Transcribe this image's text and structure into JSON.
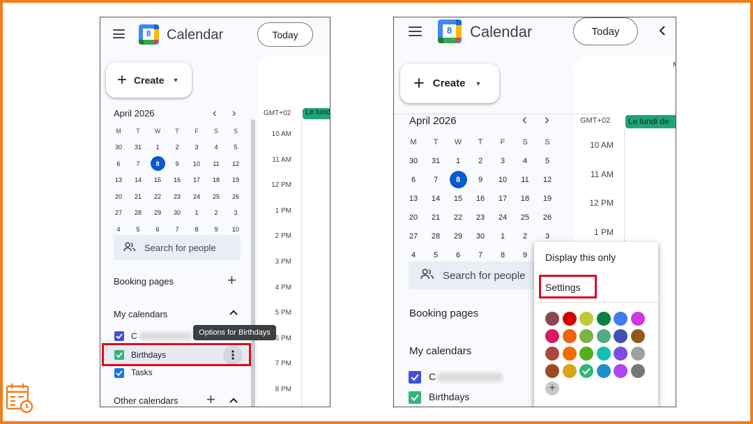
{
  "app": {
    "title": "Calendar",
    "logo_day": "8",
    "today_label": "Today",
    "create_label": "Create"
  },
  "mini_calendar": {
    "month_label": "April 2026",
    "prev_icon": "‹",
    "next_icon": "›",
    "weekday_headers": [
      "M",
      "T",
      "W",
      "T",
      "F",
      "S",
      "S"
    ],
    "weeks": [
      [
        "30",
        "31",
        "1",
        "2",
        "3",
        "4",
        "5"
      ],
      [
        "6",
        "7",
        "8",
        "9",
        "10",
        "11",
        "12"
      ],
      [
        "13",
        "14",
        "15",
        "16",
        "17",
        "18",
        "19"
      ],
      [
        "20",
        "21",
        "22",
        "23",
        "24",
        "25",
        "26"
      ],
      [
        "27",
        "28",
        "29",
        "30",
        "1",
        "2",
        "3"
      ],
      [
        "4",
        "5",
        "6",
        "7",
        "8",
        "9",
        "10"
      ]
    ],
    "selected_day": "8"
  },
  "search_people": {
    "placeholder": "Search for people"
  },
  "sidebar": {
    "booking_pages": "Booking pages",
    "my_calendars": "My calendars",
    "other_calendars": "Other calendars",
    "calendars": [
      {
        "label": "C",
        "color": "#3f51d6"
      },
      {
        "label": "Birthdays",
        "color": "#33b679"
      },
      {
        "label": "Tasks",
        "color": "#1a73e8"
      }
    ]
  },
  "day_view": {
    "timezone": "GMT+02",
    "all_day_event_short": "Le lundi",
    "all_day_event_long": "Le lundi de",
    "hours_left": [
      "10 AM",
      "11 AM",
      "12 PM",
      "1 PM",
      "2 PM",
      "3 PM",
      "4 PM",
      "5 PM",
      "6 PM",
      "7 PM",
      "8 PM"
    ],
    "hours_right": [
      "10 AM",
      "11 AM",
      "12 PM",
      "1 PM"
    ]
  },
  "tooltip": {
    "text": "Options for Birthdays"
  },
  "options_menu": {
    "display_only": "Display this only",
    "settings": "Settings",
    "add_color_icon": "+",
    "colors": [
      [
        "#8a4653",
        "#d50000",
        "#c0ca33",
        "#0b8043",
        "#3f7ee8",
        "#d137dc"
      ],
      [
        "#d81b60",
        "#e9650e",
        "#7cb342",
        "#4fae81",
        "#3f51b5",
        "#8e5b1c"
      ],
      [
        "#a94840",
        "#ef6c00",
        "#4fb219",
        "#13bfb1",
        "#7b4de0",
        "#a0a0a0"
      ],
      [
        "#9e4a21",
        "#d9a416",
        "#33b679",
        "#1e8fc9",
        "#ab47f0",
        "#777777"
      ]
    ],
    "selected_color": "#33b679"
  },
  "brand_icon": "calendar-clock-icon",
  "accent_color": "#f07e1c"
}
